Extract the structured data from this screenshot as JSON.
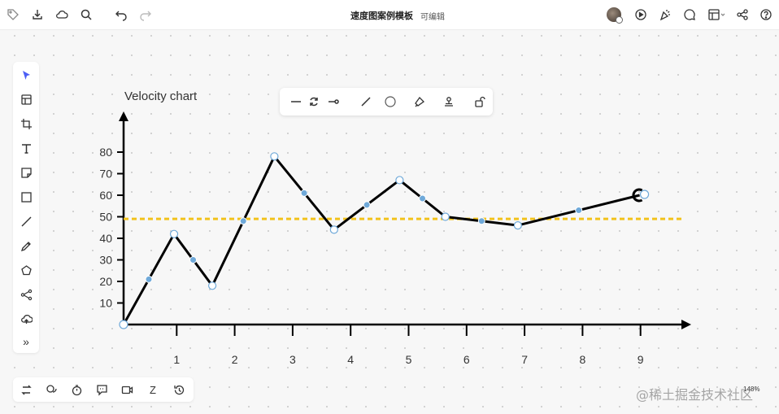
{
  "app": {
    "doc_title": "速度图案例模板",
    "doc_status": "可编辑",
    "zoom": "148%",
    "watermark": "@稀土掘金技术社区"
  },
  "topbar": {
    "left_icons": [
      "tag-icon",
      "download-icon",
      "cloud-icon",
      "search-icon",
      "undo-icon",
      "redo-icon"
    ],
    "right_icons": [
      "avatar",
      "play-icon",
      "celebrate-icon",
      "comment-icon",
      "layout-icon",
      "share-icon",
      "help-icon"
    ]
  },
  "left_toolbar": {
    "tools": [
      "select-icon",
      "frame-template-icon",
      "crop-icon",
      "text-icon",
      "sticky-note-icon",
      "rectangle-icon",
      "line-icon",
      "pen-icon",
      "pentagon-icon",
      "mindmap-icon",
      "upload-icon",
      "more-icon"
    ],
    "more_label": "»"
  },
  "bottom_toolbar": {
    "tools": [
      "swap-icon",
      "chat-icon",
      "timer-icon",
      "message-icon",
      "video-icon",
      "sleep-icon",
      "history-icon"
    ],
    "sleep_label": "Z"
  },
  "float_toolbar": {
    "tools": [
      "line-style-icon",
      "rotate-icon",
      "arrow-end-icon",
      "straight-line-icon",
      "circle-icon",
      "paint-icon",
      "stamp-icon",
      "unlock-icon"
    ]
  },
  "colors": {
    "accent": "#4c5ff5",
    "line": "#000000",
    "average_line": "#f2c21b",
    "midpoint": "#6fa9d9"
  },
  "chart_data": {
    "type": "line",
    "title": "Velocity chart",
    "xlabel": "",
    "ylabel": "",
    "x_ticks": [
      1,
      2,
      3,
      4,
      5,
      6,
      7,
      8,
      9
    ],
    "y_ticks": [
      10,
      20,
      30,
      40,
      50,
      60,
      70,
      80
    ],
    "xlim": [
      0,
      9.9
    ],
    "ylim": [
      0,
      90
    ],
    "series": [
      {
        "x": [
          0,
          0.87,
          1.53,
          2.6,
          3.63,
          4.76,
          5.55,
          6.8,
          8.9
        ],
        "y": [
          0,
          42,
          18,
          78,
          44,
          67,
          50,
          46,
          60
        ]
      }
    ],
    "average_line": 49,
    "grid": false,
    "legend": "none"
  }
}
